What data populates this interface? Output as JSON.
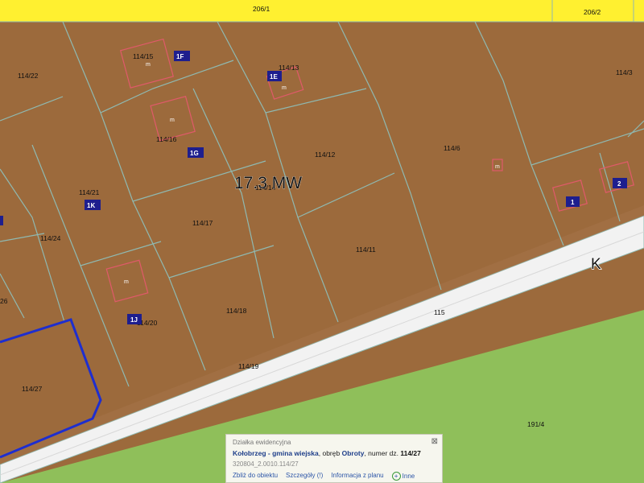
{
  "colors": {
    "residential": "#9c6a3c",
    "green": "#8fbf5a",
    "yellow": "#fff030",
    "road": "#f2f2f2",
    "boundary": "#8fb9b1",
    "building": "#e05a6a",
    "badge": "#1e1e8e",
    "selection": "#1e2ecf"
  },
  "top_parcels": [
    "206/1",
    "206/2"
  ],
  "parcels": [
    "114/15",
    "114/22",
    "114/13",
    "114/3",
    "114/16",
    "114/12",
    "114/6",
    "114/21",
    "114/14",
    "114/17",
    "114/24",
    "114/11",
    "114/18",
    "114/20",
    "114/19",
    "114/27",
    "191/4"
  ],
  "left_edge_label": "26",
  "zone_label": "17.3 MW",
  "road_letter": "K",
  "road_number": "115",
  "building_marker": "m",
  "badges": [
    "1F",
    "1E",
    "1G",
    "1K",
    "1J",
    "1",
    "2"
  ],
  "popup": {
    "title": "Działka ewidencyjna",
    "municipality": "Kołobrzeg - gmina wiejska",
    "precinct_prefix": ", obręb ",
    "precinct": "Obroty",
    "number_prefix": ", numer dz. ",
    "number": "114/27",
    "code": "320804_2.0010.114/27",
    "links": {
      "zoom": "Zbliż do obiektu",
      "details": "Szczegóły (!)",
      "plan": "Informacja z planu",
      "other": "Inne"
    },
    "close_icon": "close-icon"
  }
}
